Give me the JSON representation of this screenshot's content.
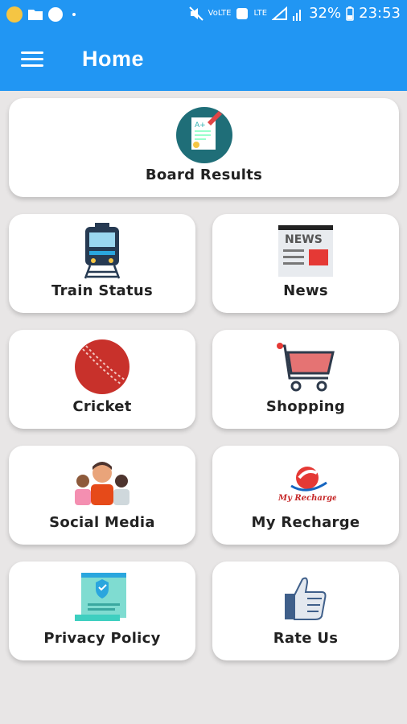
{
  "status_bar": {
    "lte_label_1": "VoLTE",
    "lte_label_2": "LTE",
    "battery": "32%",
    "time": "23:53"
  },
  "app_bar": {
    "title": "Home"
  },
  "menu": {
    "board_results": "Board Results",
    "train_status": "Train Status",
    "news": "News",
    "news_icon_text": "NEWS",
    "cricket": "Cricket",
    "shopping": "Shopping",
    "social_media": "Social Media",
    "my_recharge": "My Recharge",
    "my_recharge_logo_text": "My Recharge",
    "privacy_policy": "Privacy Policy",
    "rate_us": "Rate Us"
  },
  "colors": {
    "primary": "#2196f3",
    "background": "#e8e6e6",
    "card": "#ffffff"
  }
}
